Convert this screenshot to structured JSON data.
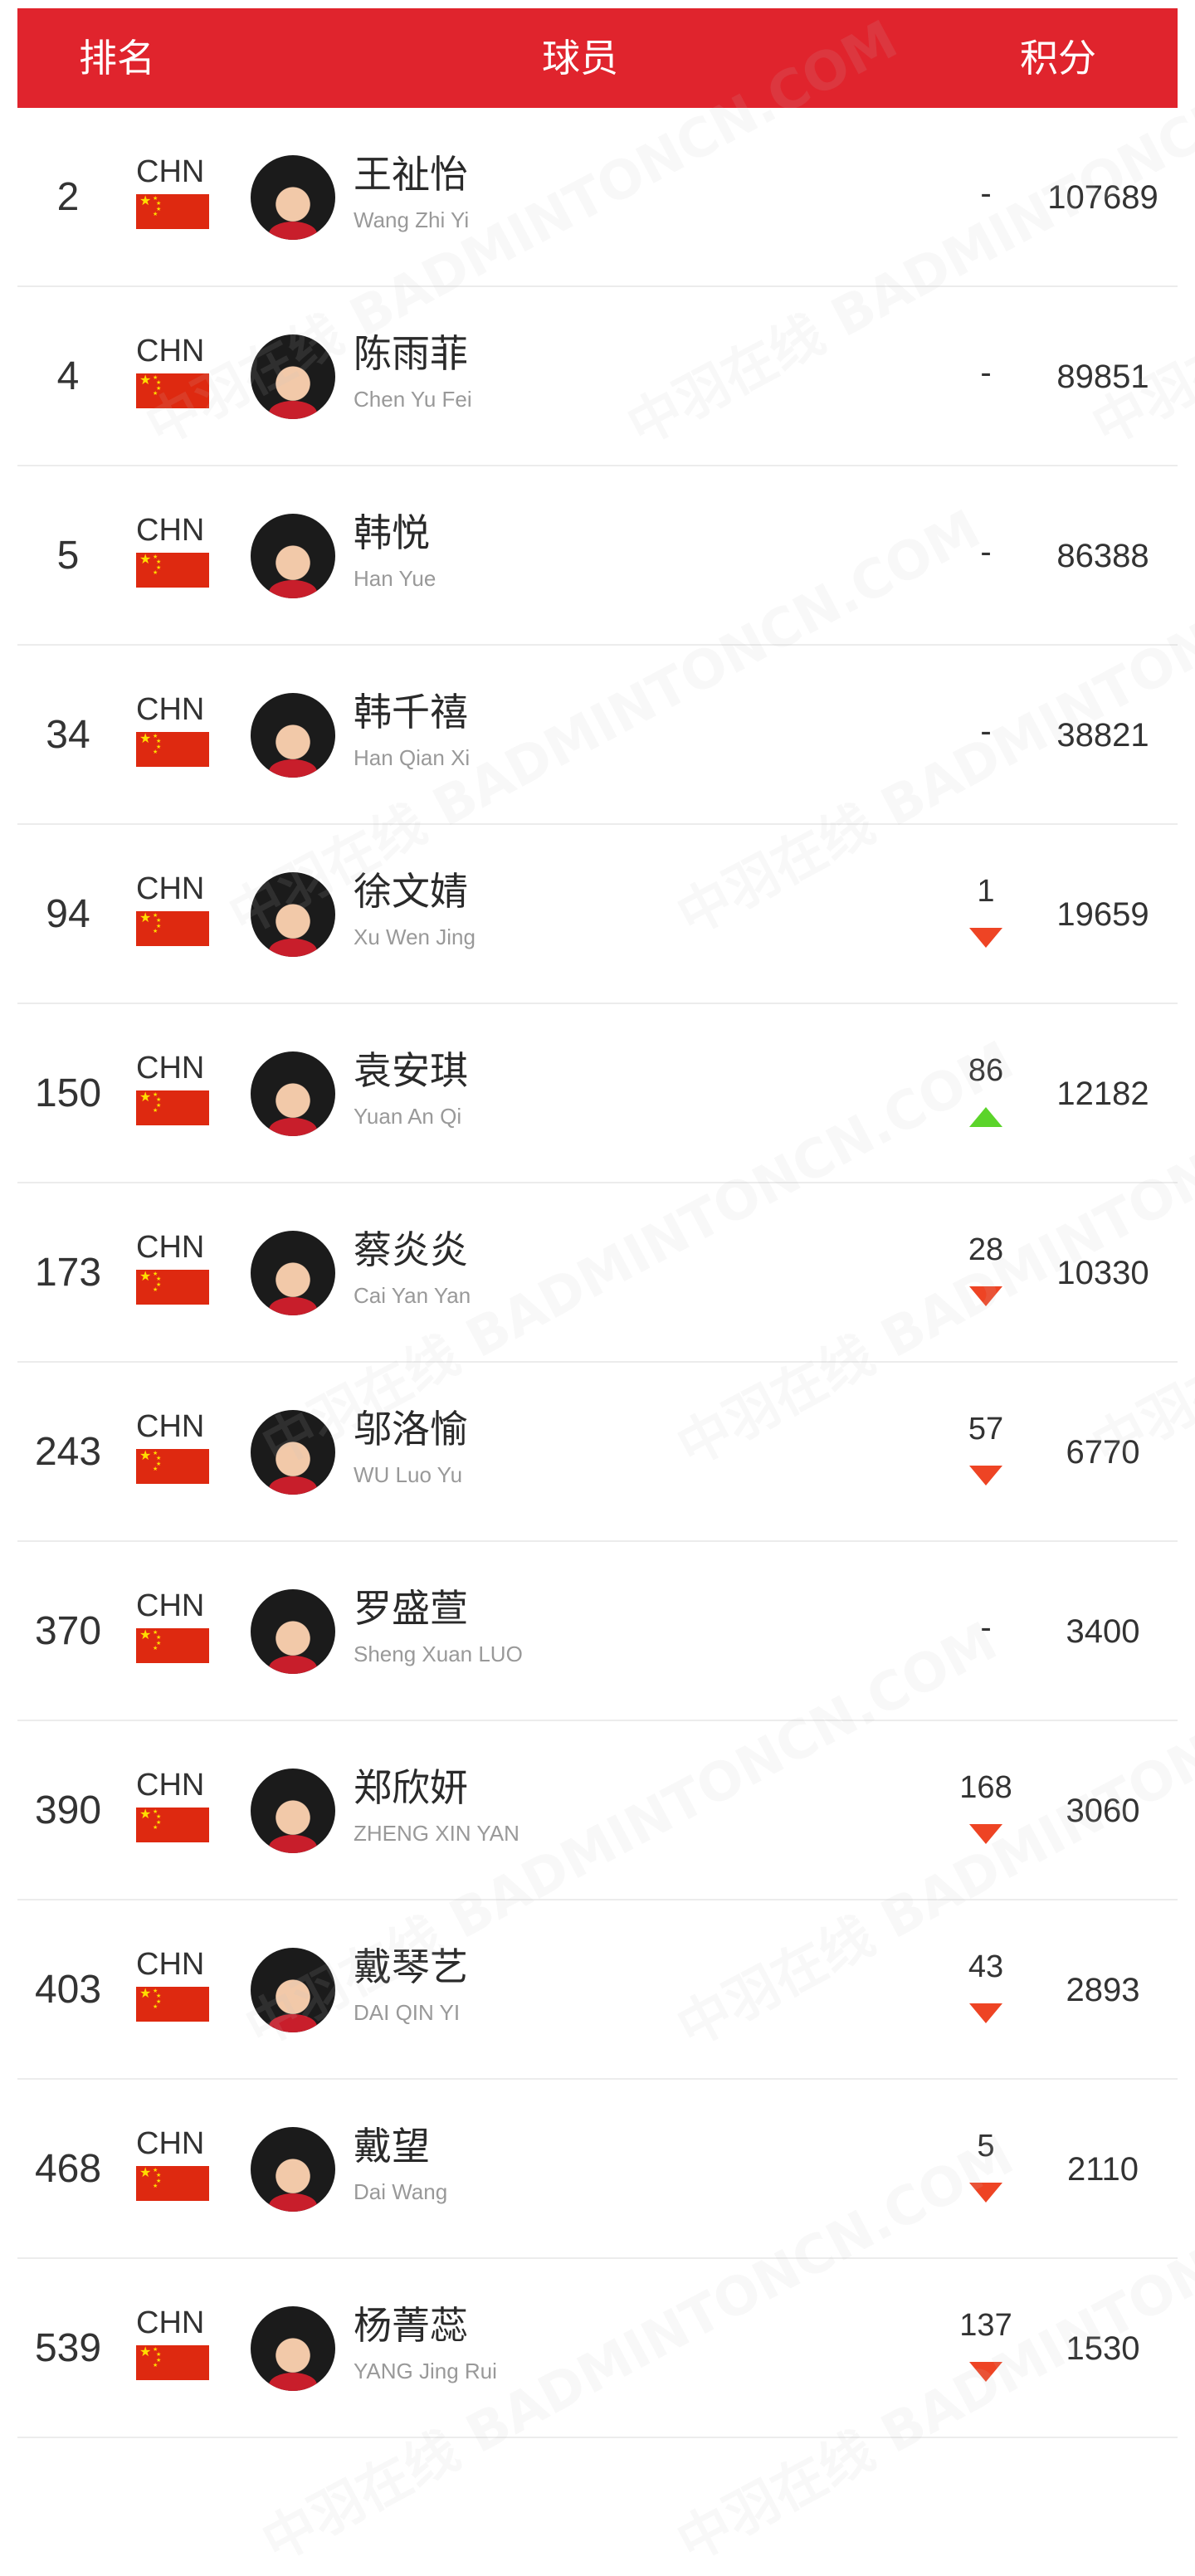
{
  "header": {
    "rank": "排名",
    "player": "球员",
    "points": "积分"
  },
  "watermark": "中羽在线 BADMINTONCN.COM",
  "colors": {
    "header": "#e0242d",
    "down": "#ee4424",
    "up": "#5bd42a"
  },
  "rows": [
    {
      "rank": "2",
      "country": "CHN",
      "name_cn": "王祉怡",
      "name_en": "Wang Zhi Yi",
      "change": "-",
      "dir": "none",
      "points": "107689"
    },
    {
      "rank": "4",
      "country": "CHN",
      "name_cn": "陈雨菲",
      "name_en": "Chen Yu Fei",
      "change": "-",
      "dir": "none",
      "points": "89851"
    },
    {
      "rank": "5",
      "country": "CHN",
      "name_cn": "韩悦",
      "name_en": "Han Yue",
      "change": "-",
      "dir": "none",
      "points": "86388"
    },
    {
      "rank": "34",
      "country": "CHN",
      "name_cn": "韩千禧",
      "name_en": "Han Qian Xi",
      "change": "-",
      "dir": "none",
      "points": "38821"
    },
    {
      "rank": "94",
      "country": "CHN",
      "name_cn": "徐文婧",
      "name_en": "Xu Wen Jing",
      "change": "1",
      "dir": "down",
      "points": "19659"
    },
    {
      "rank": "150",
      "country": "CHN",
      "name_cn": "袁安琪",
      "name_en": "Yuan An Qi",
      "change": "86",
      "dir": "up",
      "points": "12182"
    },
    {
      "rank": "173",
      "country": "CHN",
      "name_cn": "蔡炎炎",
      "name_en": "Cai Yan Yan",
      "change": "28",
      "dir": "down",
      "points": "10330"
    },
    {
      "rank": "243",
      "country": "CHN",
      "name_cn": "邬洛愉",
      "name_en": "WU Luo Yu",
      "change": "57",
      "dir": "down",
      "points": "6770"
    },
    {
      "rank": "370",
      "country": "CHN",
      "name_cn": "罗盛萱",
      "name_en": "Sheng Xuan LUO",
      "change": "-",
      "dir": "none",
      "points": "3400"
    },
    {
      "rank": "390",
      "country": "CHN",
      "name_cn": "郑欣妍",
      "name_en": "ZHENG XIN YAN",
      "change": "168",
      "dir": "down",
      "points": "3060"
    },
    {
      "rank": "403",
      "country": "CHN",
      "name_cn": "戴琴艺",
      "name_en": "DAI QIN YI",
      "change": "43",
      "dir": "down",
      "points": "2893"
    },
    {
      "rank": "468",
      "country": "CHN",
      "name_cn": "戴望",
      "name_en": "Dai Wang",
      "change": "5",
      "dir": "down",
      "points": "2110"
    },
    {
      "rank": "539",
      "country": "CHN",
      "name_cn": "杨菁蕊",
      "name_en": "YANG Jing Rui",
      "change": "137",
      "dir": "down",
      "points": "1530"
    }
  ]
}
